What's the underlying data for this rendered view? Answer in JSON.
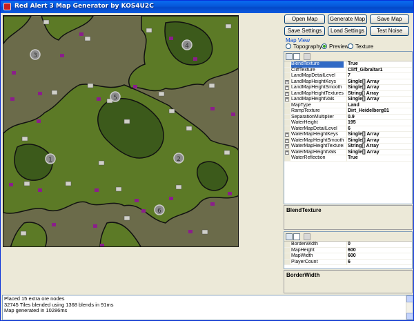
{
  "window": {
    "title": "Red Alert 3 Map Generator by KOS4U2C"
  },
  "toolbar": {
    "open_map": "Open Map",
    "generate_map": "Generate Map",
    "save_map": "Save Map",
    "save_settings": "Save Settings",
    "load_settings": "Load Settings",
    "test_noise": "Test Noise"
  },
  "map_view": {
    "label": "Map View",
    "options": [
      "Topography",
      "Preview",
      "Texture"
    ],
    "selected": "Preview"
  },
  "map": {
    "start_positions": [
      "1",
      "2",
      "3",
      "4",
      "5",
      "6"
    ],
    "colors": {
      "low": "#6b6b4a",
      "mid": "#5c7a26",
      "high": "#3c5a1b",
      "ore": "#8b1e8b",
      "node": "#d0d0c8",
      "outline": "#111111"
    }
  },
  "properties": {
    "rows": [
      {
        "name": "BlendTexture",
        "value": "True",
        "expandable": false,
        "selected": true
      },
      {
        "name": "CliffTexture",
        "value": "Cliff_Gibraltar1",
        "expandable": false
      },
      {
        "name": "LandMapDetailLevel",
        "value": "7",
        "expandable": false
      },
      {
        "name": "LandMapHeightKeys",
        "value": "Single[] Array",
        "expandable": true
      },
      {
        "name": "LandMapHeightSmooth",
        "value": "Single[] Array",
        "expandable": true
      },
      {
        "name": "LandMapHeightTextures",
        "value": "String[] Array",
        "expandable": true
      },
      {
        "name": "LandMapHeightVals",
        "value": "Single[] Array",
        "expandable": true
      },
      {
        "name": "MapType",
        "value": "Land",
        "expandable": false
      },
      {
        "name": "RampTexture",
        "value": "Dirt_Heidelberg01",
        "expandable": false
      },
      {
        "name": "SeparationMultiplier",
        "value": "0.9",
        "expandable": false
      },
      {
        "name": "WaterHeight",
        "value": "195",
        "expandable": false
      },
      {
        "name": "WaterMapDetailLevel",
        "value": "6",
        "expandable": false
      },
      {
        "name": "WaterMapHeightKeys",
        "value": "Single[] Array",
        "expandable": true
      },
      {
        "name": "WaterMapHeightSmooth",
        "value": "Single[] Array",
        "expandable": true
      },
      {
        "name": "WaterMapHeightTextures",
        "value": "String[] Array",
        "expandable": true
      },
      {
        "name": "WaterMapHeightVals",
        "value": "Single[] Array",
        "expandable": true
      },
      {
        "name": "WaterReflection",
        "value": "True",
        "expandable": false
      }
    ],
    "description": "BlendTexture"
  },
  "properties2": {
    "rows": [
      {
        "name": "BorderWidth",
        "value": "0"
      },
      {
        "name": "MapHeight",
        "value": "600"
      },
      {
        "name": "MapWidth",
        "value": "600"
      },
      {
        "name": "PlayerCount",
        "value": "6"
      }
    ],
    "description": "BorderWidth"
  },
  "log": {
    "lines": [
      "Placed 15 extra ore nodes",
      "32745 Tiles blended using 1368 blends in 91ms",
      "Map generated in 10286ms"
    ]
  }
}
